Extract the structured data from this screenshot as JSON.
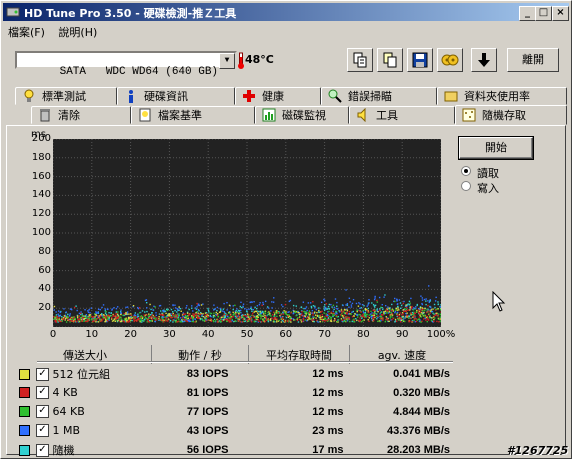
{
  "window": {
    "title": "HD Tune Pro 3.50 - 硬碟檢測-推Ｚ工具"
  },
  "titlebar_buttons": {
    "minimize": "_",
    "maximize": "□",
    "close": "×"
  },
  "menu": [
    "檔案(F)",
    "說明(H)"
  ],
  "toolbar": {
    "drive": "SATA   WDC WD64 (640 GB)",
    "temperature": "48°C",
    "exit_label": "離開",
    "icons": [
      "copy-text-icon",
      "copy-screen-icon",
      "save-icon",
      "options-icon",
      "download-icon"
    ]
  },
  "tabs_top": [
    {
      "label": "標準測試",
      "icon": "bulb-icon"
    },
    {
      "label": "硬碟資訊",
      "icon": "info-icon"
    },
    {
      "label": "健康",
      "icon": "health-cross-icon"
    },
    {
      "label": "錯誤掃瞄",
      "icon": "magnifier-icon"
    },
    {
      "label": "資料夾使用率",
      "icon": "folder-icon"
    }
  ],
  "tabs_bottom": [
    {
      "label": "清除",
      "icon": "trash-icon"
    },
    {
      "label": "檔案基準",
      "icon": "file-bulb-icon"
    },
    {
      "label": "磁碟監視",
      "icon": "monitor-icon"
    },
    {
      "label": "工具",
      "icon": "speaker-icon"
    },
    {
      "label": "隨機存取",
      "icon": "random-access-icon"
    }
  ],
  "chart_data": {
    "type": "scatter",
    "ylabel": "ms",
    "yticks": [
      "200",
      "180",
      "160",
      "140",
      "120",
      "100",
      "80",
      "60",
      "40",
      "20"
    ],
    "xticks": [
      "0",
      "10",
      "20",
      "30",
      "40",
      "50",
      "60",
      "70",
      "80",
      "90",
      "100%"
    ],
    "ylim": [
      0,
      200
    ],
    "xlim": [
      0,
      100
    ],
    "grid": true,
    "series": [
      {
        "color": "#e0e040",
        "band": [
          [
            0,
            13
          ],
          [
            100,
            22
          ]
        ]
      },
      {
        "color": "#d02020",
        "band": [
          [
            0,
            12
          ],
          [
            100,
            20
          ]
        ]
      },
      {
        "color": "#30c030",
        "band": [
          [
            0,
            12
          ],
          [
            100,
            21
          ]
        ]
      },
      {
        "color": "#3070ff",
        "band": [
          [
            0,
            20
          ],
          [
            100,
            35
          ]
        ]
      },
      {
        "color": "#30d0d0",
        "band": [
          [
            0,
            16
          ],
          [
            100,
            30
          ]
        ]
      }
    ]
  },
  "controls": {
    "start_label": "開始",
    "read_label": "讀取",
    "write_label": "寫入"
  },
  "table": {
    "headers": [
      "傳送大小",
      "動作 / 秒",
      "平均存取時間",
      "agv. 速度"
    ],
    "rows": [
      {
        "label": "512 位元組",
        "color": "#e0e040",
        "ops": "83 IOPS",
        "time": "12 ms",
        "speed": "0.041 MB/s"
      },
      {
        "label": "4 KB",
        "color": "#d02020",
        "ops": "81 IOPS",
        "time": "12 ms",
        "speed": "0.320 MB/s"
      },
      {
        "label": "64 KB",
        "color": "#30c030",
        "ops": "77 IOPS",
        "time": "12 ms",
        "speed": "4.844 MB/s"
      },
      {
        "label": "1 MB",
        "color": "#3070ff",
        "ops": "43 IOPS",
        "time": "23 ms",
        "speed": "43.376 MB/s"
      },
      {
        "label": "隨機",
        "color": "#30d0d0",
        "ops": "56 IOPS",
        "time": "17 ms",
        "speed": "28.203 MB/s"
      }
    ]
  },
  "watermark": "#1267725"
}
